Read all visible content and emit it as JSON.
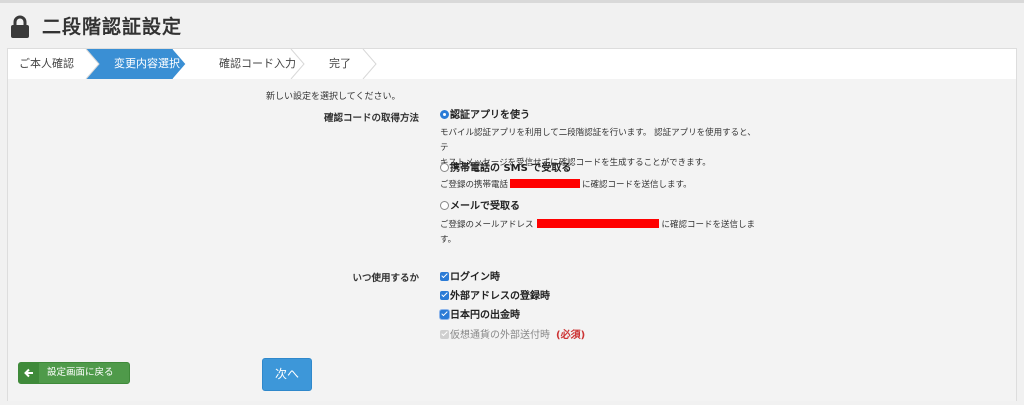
{
  "page": {
    "title": "二段階認証設定"
  },
  "steps": [
    {
      "label": "ご本人確認"
    },
    {
      "label": "変更内容選択"
    },
    {
      "label": "確認コード入力"
    },
    {
      "label": "完了"
    }
  ],
  "form": {
    "intro": "新しい設定を選択してください。",
    "method_label": "確認コードの取得方法",
    "options": [
      {
        "label": "認証アプリを使う",
        "selected": true,
        "desc_line1": "モバイル認証アプリを利用して二段階認証を行います。 認証アプリを使用すると、テ",
        "desc_line2": "キストメッセージを受信せずに確認コードを生成することができます。"
      },
      {
        "label": "携帯電話の SMS で受取る",
        "selected": false,
        "desc_pre": "ご登録の携帯電話",
        "desc_post": "に確認コードを送信します。"
      },
      {
        "label": "メールで受取る",
        "selected": false,
        "desc_pre": "ご登録のメールアドレス",
        "desc_post": "に確認コードを送信しま",
        "desc_line2": "す。"
      }
    ],
    "usage_label": "いつ使用するか",
    "usage": [
      {
        "label": "ログイン時",
        "checked": true
      },
      {
        "label": "外部アドレスの登録時",
        "checked": true
      },
      {
        "label": "日本円の出金時",
        "checked": true
      },
      {
        "label": "仮想通貨の外部送付時",
        "checked": true,
        "disabled": true,
        "required": "(必須)"
      }
    ]
  },
  "buttons": {
    "back": "設定画面に戻る",
    "next": "次へ"
  },
  "colors": {
    "accent": "#3d97d9",
    "step_active": "#3a8fd4",
    "back_green": "#4f9a4a",
    "required": "#cc3333"
  }
}
